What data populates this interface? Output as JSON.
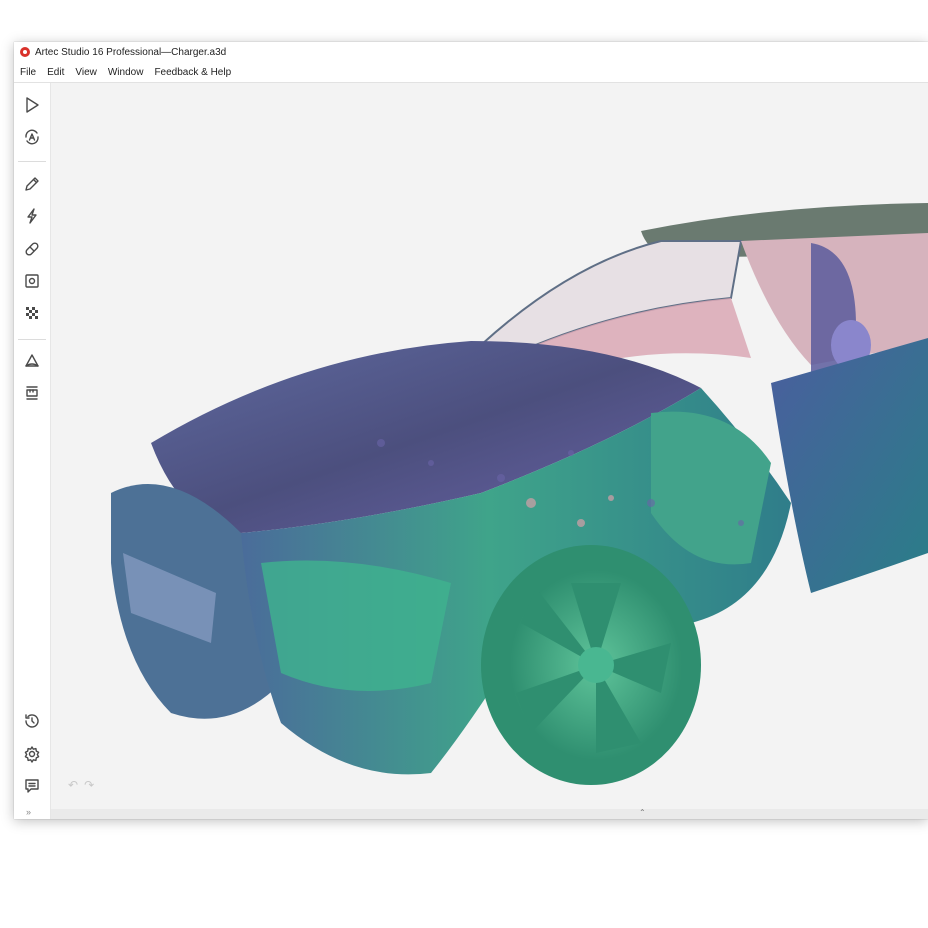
{
  "window": {
    "title": "Artec Studio 16 Professional—Charger.a3d"
  },
  "menu": [
    "File",
    "Edit",
    "View",
    "Window",
    "Feedback & Help"
  ],
  "toolbar": {
    "top": [
      "play-icon",
      "autopilot-icon"
    ],
    "middle": [
      "pencil-icon",
      "lightning-icon",
      "bandage-icon",
      "target-icon",
      "checker-icon"
    ],
    "lower": [
      "triangle-icon",
      "ruler-icon"
    ],
    "bottom": [
      "history-icon",
      "settings-icon",
      "chat-icon"
    ],
    "expand": "»"
  },
  "bottom_strip": {
    "toggle": "»"
  },
  "viewport": {
    "undo": "↶",
    "redo": "↷",
    "background": "#f3f3f3"
  },
  "colors": {
    "accent": "#d9322b",
    "scan_green": "#3fb38e",
    "scan_blue": "#4a6c9a",
    "scan_purple": "#6a64a8",
    "scan_pink": "#d6a0a8"
  }
}
